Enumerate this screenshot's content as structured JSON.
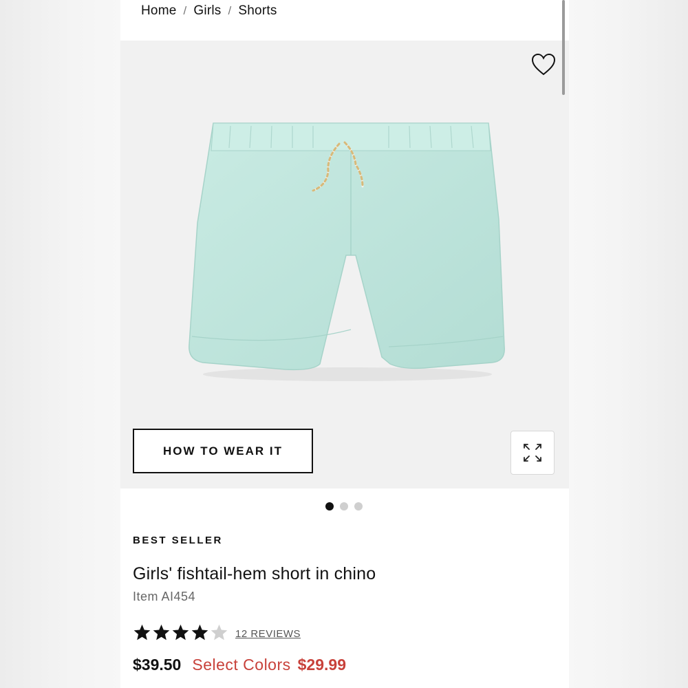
{
  "breadcrumb": {
    "home": "Home",
    "girls": "Girls",
    "shorts": "Shorts",
    "separator": "/"
  },
  "gallery": {
    "how_to_wear": "HOW TO WEAR IT",
    "image_count": 3,
    "active_image": 1
  },
  "product": {
    "badge": "BEST SELLER",
    "title": "Girls' fishtail-hem short in chino",
    "item": "Item AI454",
    "rating": 4,
    "rating_max": 5,
    "reviews": "12 REVIEWS",
    "price_regular": "$39.50",
    "select_colors": "Select Colors",
    "price_sale": "$29.99"
  },
  "colors": {
    "accent_sale": "#c8413a",
    "product_mint": "#bfe4dc",
    "text": "#111111"
  },
  "icons": [
    "heart-icon",
    "expand-icon",
    "star-icon"
  ]
}
